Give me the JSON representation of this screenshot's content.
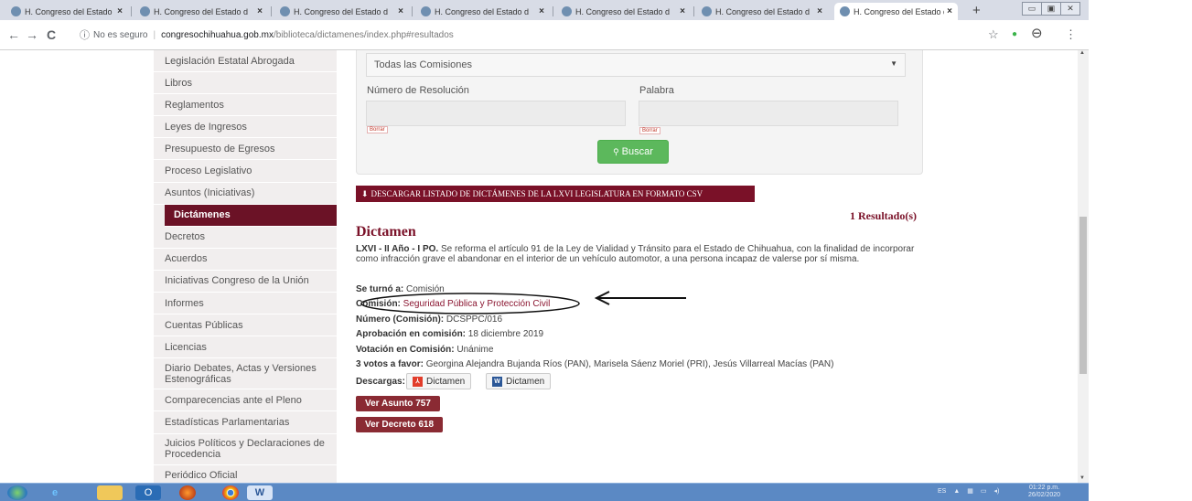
{
  "browser": {
    "tabs": [
      {
        "title": "H. Congreso del Estado d",
        "active": false
      },
      {
        "title": "H. Congreso del Estado d",
        "active": false
      },
      {
        "title": "H. Congreso del Estado d",
        "active": false
      },
      {
        "title": "H. Congreso del Estado d",
        "active": false
      },
      {
        "title": "H. Congreso del Estado d",
        "active": false
      },
      {
        "title": "H. Congreso del Estado d",
        "active": false
      },
      {
        "title": "H. Congreso del Estado d",
        "active": true
      }
    ],
    "close_glyph": "×",
    "new_tab": "+",
    "window_controls": {
      "minimize": "▭",
      "maximize": "▣",
      "close": "✕"
    },
    "back": "←",
    "forward": "→",
    "reload": "C",
    "security_icon": "ⓘ",
    "security_text": "No es seguro",
    "url_host": "congresochihuahua.gob.mx",
    "url_path": "/biblioteca/dictamenes/index.php#resultados",
    "star": "☆",
    "extension": "●",
    "profile": "⊖",
    "menu": "⋮"
  },
  "sidebar": {
    "items": [
      {
        "label": "Legislación Estatal Abrogada"
      },
      {
        "label": "Libros"
      },
      {
        "label": "Reglamentos"
      },
      {
        "label": "Leyes de Ingresos"
      },
      {
        "label": "Presupuesto de Egresos"
      },
      {
        "label": "Proceso Legislativo"
      },
      {
        "label": "Asuntos (Iniciativas)"
      },
      {
        "label": "Dictámenes",
        "active": true
      },
      {
        "label": "Decretos"
      },
      {
        "label": "Acuerdos"
      },
      {
        "label": "Iniciativas Congreso de la Unión"
      },
      {
        "label": "Informes"
      },
      {
        "label": "Cuentas Públicas"
      },
      {
        "label": "Licencias"
      },
      {
        "label": "Diario Debates, Actas y Versiones Estenográficas",
        "two_line": true
      },
      {
        "label": "Comparecencias ante el Pleno"
      },
      {
        "label": "Estadísticas Parlamentarias"
      },
      {
        "label": "Juicios Políticos y Declaraciones de Procedencia",
        "two_line": true
      },
      {
        "label": "Periódico Oficial"
      }
    ]
  },
  "filters": {
    "commission_select": "Todas las Comisiones",
    "resolution_label": "Número de Resolución",
    "word_label": "Palabra",
    "clear_label": "Borrar",
    "search_button": "Buscar",
    "search_icon": "🔍"
  },
  "csv_button": "DESCARGAR LISTADO DE DICTÁMENES DE LA LXVI LEGISLATURA EN FORMATO CSV",
  "results_count": "1 Resultado(s)",
  "result": {
    "heading": "Dictamen",
    "period": "LXVI - II Año - I PO.",
    "description": "Se reforma el artículo 91 de la Ley de Vialidad y Tránsito para el Estado de Chihuahua, con la finalidad de incorporar como infracción grave el abandonar en el interior de un vehículo automotor, a una persona incapaz de valerse por sí misma.",
    "turned_label": "Se turnó a:",
    "turned_value": "Comisión",
    "commission_label": "Comisión:",
    "commission_value": "Seguridad Pública y Protección Civil",
    "number_label": "Número (Comisión):",
    "number_value": "DCSPPC/016",
    "approval_label": "Aprobación en comisión:",
    "approval_value": "18 diciembre 2019",
    "vote_label": "Votación en Comisión:",
    "vote_value": "Unánime",
    "favor_label": "3 votos a favor:",
    "favor_value": "Georgina Alejandra Bujanda Ríos (PAN), Marisela Sáenz Moriel (PRI), Jesús Villarreal Macías (PAN)",
    "downloads_label": "Descargas:",
    "download_pdf": "Dictamen",
    "download_word": "Dictamen",
    "pdf_icon_text": "⅄",
    "word_icon_text": "W",
    "btn_asunto": "Ver Asunto 757",
    "btn_decreto": "Ver Decreto 618"
  },
  "taskbar": {
    "lang": "ES",
    "time": "01:22 p.m.",
    "date": "26/02/2020"
  }
}
